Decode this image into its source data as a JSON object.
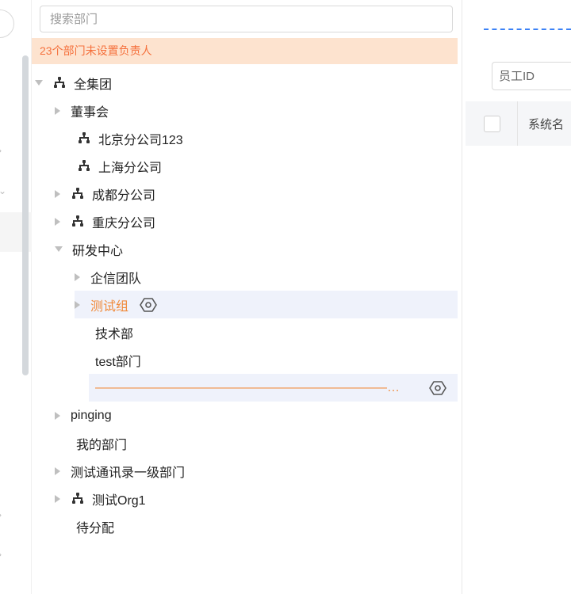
{
  "tree_panel": {
    "search_placeholder": "搜索部门",
    "notice": "23个部门未设置负责人",
    "nodes": [
      {
        "label": "全集团"
      },
      {
        "label": "董事会"
      },
      {
        "label": "北京分公司123"
      },
      {
        "label": "上海分公司"
      },
      {
        "label": "成都分公司"
      },
      {
        "label": "重庆分公司"
      },
      {
        "label": "研发中心"
      },
      {
        "label": "企信团队"
      },
      {
        "label": "测试组"
      },
      {
        "label": "技术部"
      },
      {
        "label": "test部门"
      },
      {
        "label": "————————————————————————————"
      },
      {
        "label": "pinging"
      },
      {
        "label": "我的部门"
      },
      {
        "label": "测试通讯录一级部门"
      },
      {
        "label": "测试Org1"
      },
      {
        "label": "待分配"
      }
    ]
  },
  "right_panel": {
    "employee_id_placeholder": "员工ID",
    "column_system_name": "系统名"
  },
  "colors": {
    "accent_orange": "#f08a3a",
    "notice_bg": "#fde3cf",
    "selected_bg": "#eff2fb",
    "link_blue": "#3c82f6"
  }
}
